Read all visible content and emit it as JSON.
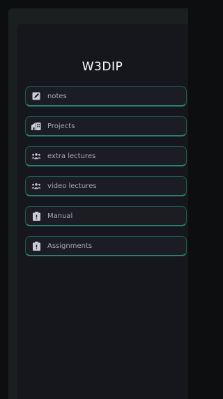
{
  "sidebar": {
    "title": "W3DIP",
    "items": [
      {
        "label": "notes",
        "icon": "note-icon"
      },
      {
        "label": "Projects",
        "icon": "building-icon"
      },
      {
        "label": "extra lectures",
        "icon": "group-icon"
      },
      {
        "label": "video lectures",
        "icon": "group-icon"
      },
      {
        "label": "Manual",
        "icon": "clipboard-icon"
      },
      {
        "label": "Assignments",
        "icon": "clipboard-icon"
      }
    ]
  },
  "colors": {
    "background": "#0c0e0f",
    "panel": "#15171c",
    "item_border": "#2b7f6d",
    "item_text": "#a7abb2",
    "icon": "#c9cdd3"
  }
}
